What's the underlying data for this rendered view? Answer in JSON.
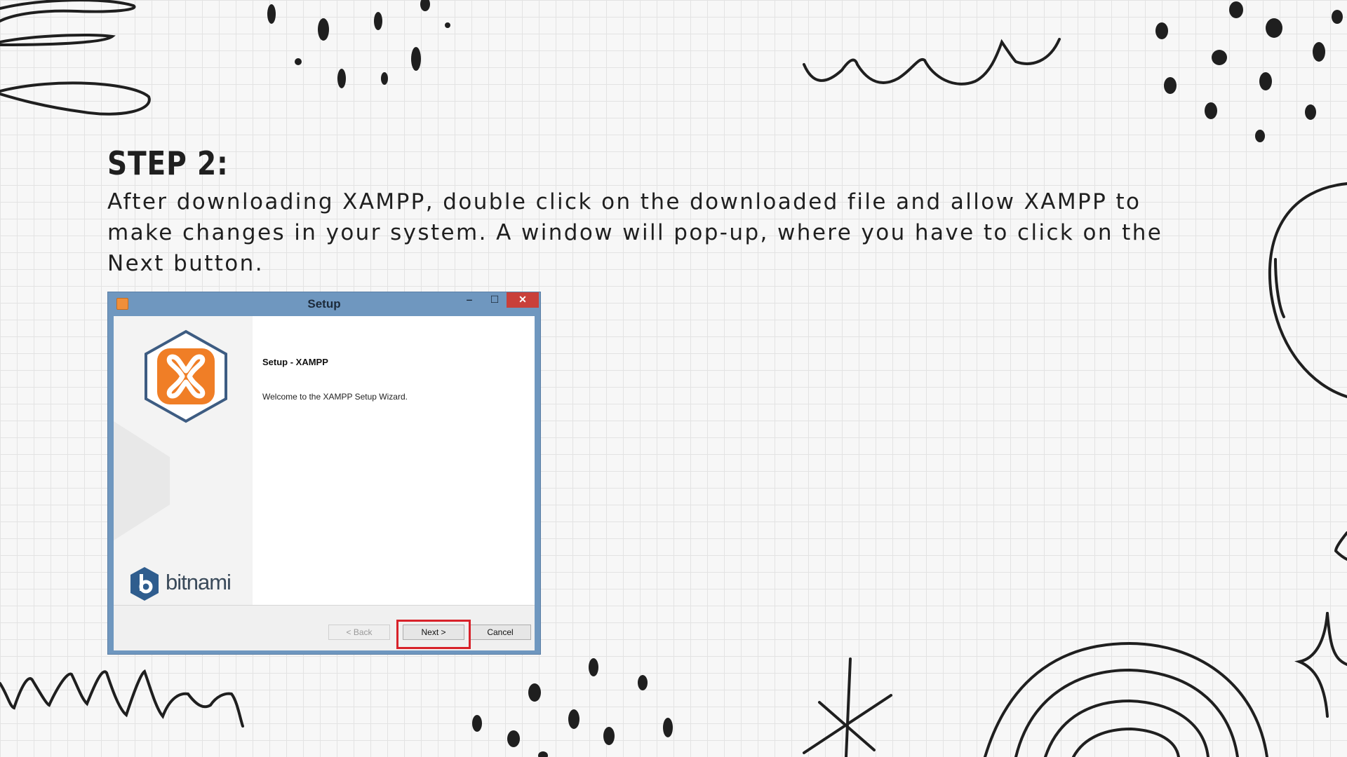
{
  "step": {
    "title": "STEP 2:",
    "text": "After downloading XAMPP, double click on the downloaded file and allow XAMPP to make changes in your system. A window will pop-up, where you have to click on the Next button."
  },
  "window": {
    "title": "Setup",
    "min_glyph": "‒",
    "max_glyph": "☐",
    "close_glyph": "✕",
    "header": "Setup - XAMPP",
    "welcome": "Welcome to the XAMPP Setup Wizard.",
    "brand": "bitnami",
    "buttons": {
      "back": "< Back",
      "next": "Next >",
      "cancel": "Cancel"
    },
    "highlight_color": "#d8222a",
    "xampp_color": "#f07e26"
  }
}
